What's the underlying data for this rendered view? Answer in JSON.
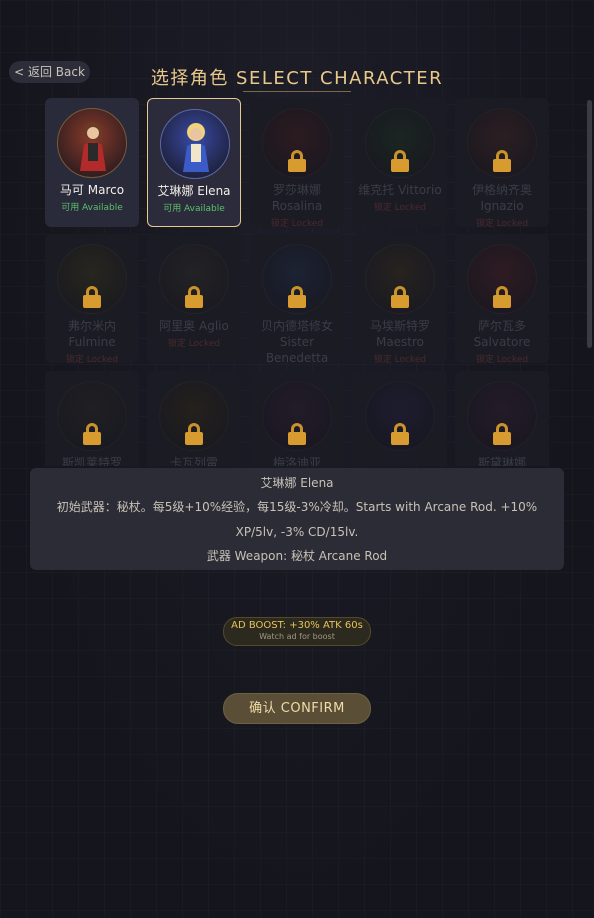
{
  "header": {
    "back_label": "< 返回 Back",
    "title": "选择角色 SELECT CHARACTER"
  },
  "characters": [
    {
      "name": "马可 Marco",
      "status": "可用 Available",
      "state": "unlocked",
      "color": "#8a3a2a"
    },
    {
      "name": "艾琳娜 Elena",
      "status": "可用 Available",
      "state": "selected",
      "color": "#3a4aa6"
    },
    {
      "name": "罗莎琳娜 Rosalina",
      "status": "锁定 Locked",
      "state": "locked",
      "color": "#3a1c1e"
    },
    {
      "name": "维克托 Vittorio",
      "status": "锁定 Locked",
      "state": "locked",
      "color": "#1c2e22"
    },
    {
      "name": "伊格纳齐奥 Ignazio",
      "status": "锁定 Locked",
      "state": "locked",
      "color": "#3a2220"
    },
    {
      "name": "弗尔米内 Fulmine",
      "status": "锁定 Locked",
      "state": "locked",
      "color": "#32301c"
    },
    {
      "name": "阿里奥 Aglio",
      "status": "锁定 Locked",
      "state": "locked",
      "color": "#2a2a28"
    },
    {
      "name": "贝内德塔修女 Sister Benedetta",
      "status": "锁定 Locked",
      "state": "locked",
      "color": "#1e2a40"
    },
    {
      "name": "马埃斯特罗 Maestro",
      "status": "锁定 Locked",
      "state": "locked",
      "color": "#302a1e"
    },
    {
      "name": "萨尔瓦多 Salvatore",
      "status": "锁定 Locked",
      "state": "locked",
      "color": "#401c22"
    },
    {
      "name": "斯凯莱特罗",
      "status": "",
      "state": "locked",
      "color": "#242424"
    },
    {
      "name": "卡瓦列雷",
      "status": "",
      "state": "locked",
      "color": "#2c2618"
    },
    {
      "name": "梅洛迪亚",
      "status": "",
      "state": "locked",
      "color": "#2a1c30"
    },
    {
      "name": "",
      "status": "",
      "state": "locked",
      "color": "#1e1e38"
    },
    {
      "name": "斯黛琳娜",
      "status": "",
      "state": "locked",
      "color": "#2c1c2c"
    }
  ],
  "info": {
    "name": "艾琳娜 Elena",
    "description": "初始武器：秘杖。每5级+10%经验，每15级-3%冷却。Starts with Arcane Rod. +10% XP/5lv, -3% CD/15lv.",
    "weapon": "武器 Weapon: 秘杖 Arcane Rod"
  },
  "ad": {
    "label": "AD BOOST: +30% ATK 60s",
    "sublabel": "Watch ad for boost"
  },
  "confirm_label": "确认 CONFIRM"
}
